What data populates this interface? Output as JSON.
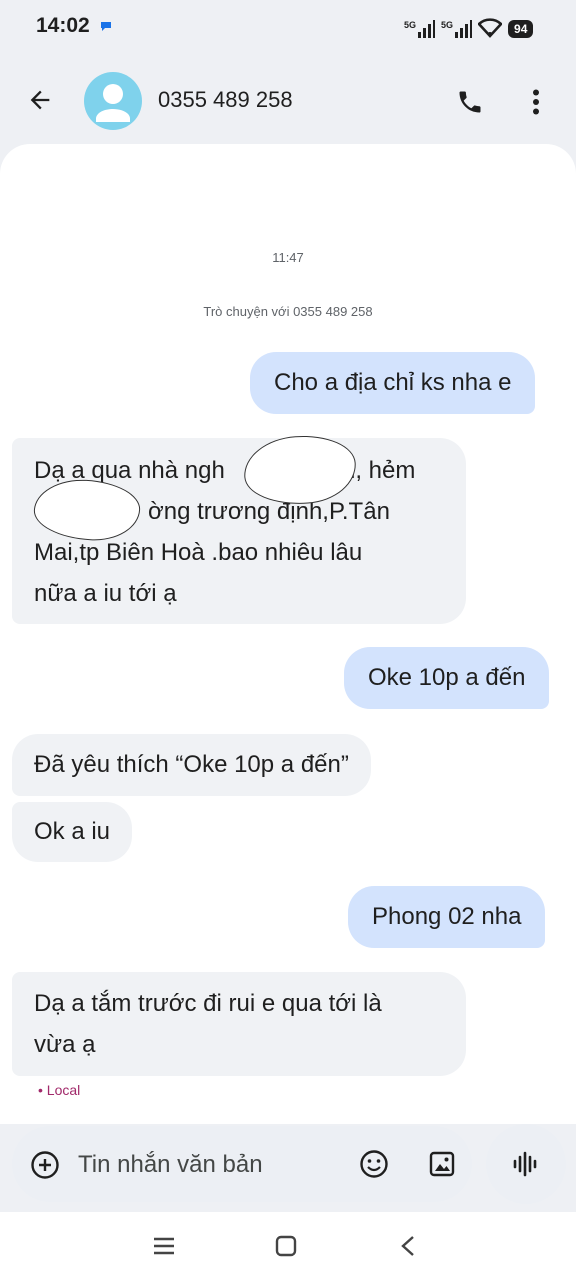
{
  "status_bar": {
    "time": "14:02",
    "signal_1": "5G",
    "signal_2": "5G",
    "battery": "94"
  },
  "header": {
    "contact": "0355 489 258"
  },
  "conversation": {
    "time": "11:47",
    "info": "Trò chuyện với 0355 489 258",
    "messages": [
      {
        "direction": "outgoing",
        "text": "Cho a địa chỉ ks nha e"
      },
      {
        "direction": "incoming",
        "lines": [
          "Dạ a qua nhà ngh",
          "ờng trương định,P.Tân",
          "Mai,tp Biên Hoà .bao nhiêu lâu",
          "nữa a iu tới ạ"
        ],
        "line1_tail": "n, hẻm"
      },
      {
        "direction": "outgoing",
        "text": "Oke 10p a đến"
      },
      {
        "direction": "incoming",
        "text": "Đã yêu thích “Oke 10p a đến”"
      },
      {
        "direction": "incoming",
        "text": "Ok a iu"
      },
      {
        "direction": "outgoing",
        "text": "Phong 02 nha"
      },
      {
        "direction": "incoming",
        "lines": [
          "Dạ a tắm trước đi rui e qua tới là",
          "vừa ạ"
        ]
      }
    ],
    "local_label": "• Local"
  },
  "compose": {
    "placeholder": "Tin nhắn văn bản"
  },
  "colors": {
    "outgoing_bubble": "#d3e3fd",
    "incoming_bubble": "#f0f2f5",
    "avatar": "#7fd2ec",
    "local": "#a1296a"
  },
  "icons": [
    "arrow-back-icon",
    "person-icon",
    "phone-icon",
    "more-vert-icon",
    "add-icon",
    "emoji-icon",
    "image-icon",
    "voice-icon",
    "menu-icon",
    "home-icon",
    "back-icon"
  ]
}
